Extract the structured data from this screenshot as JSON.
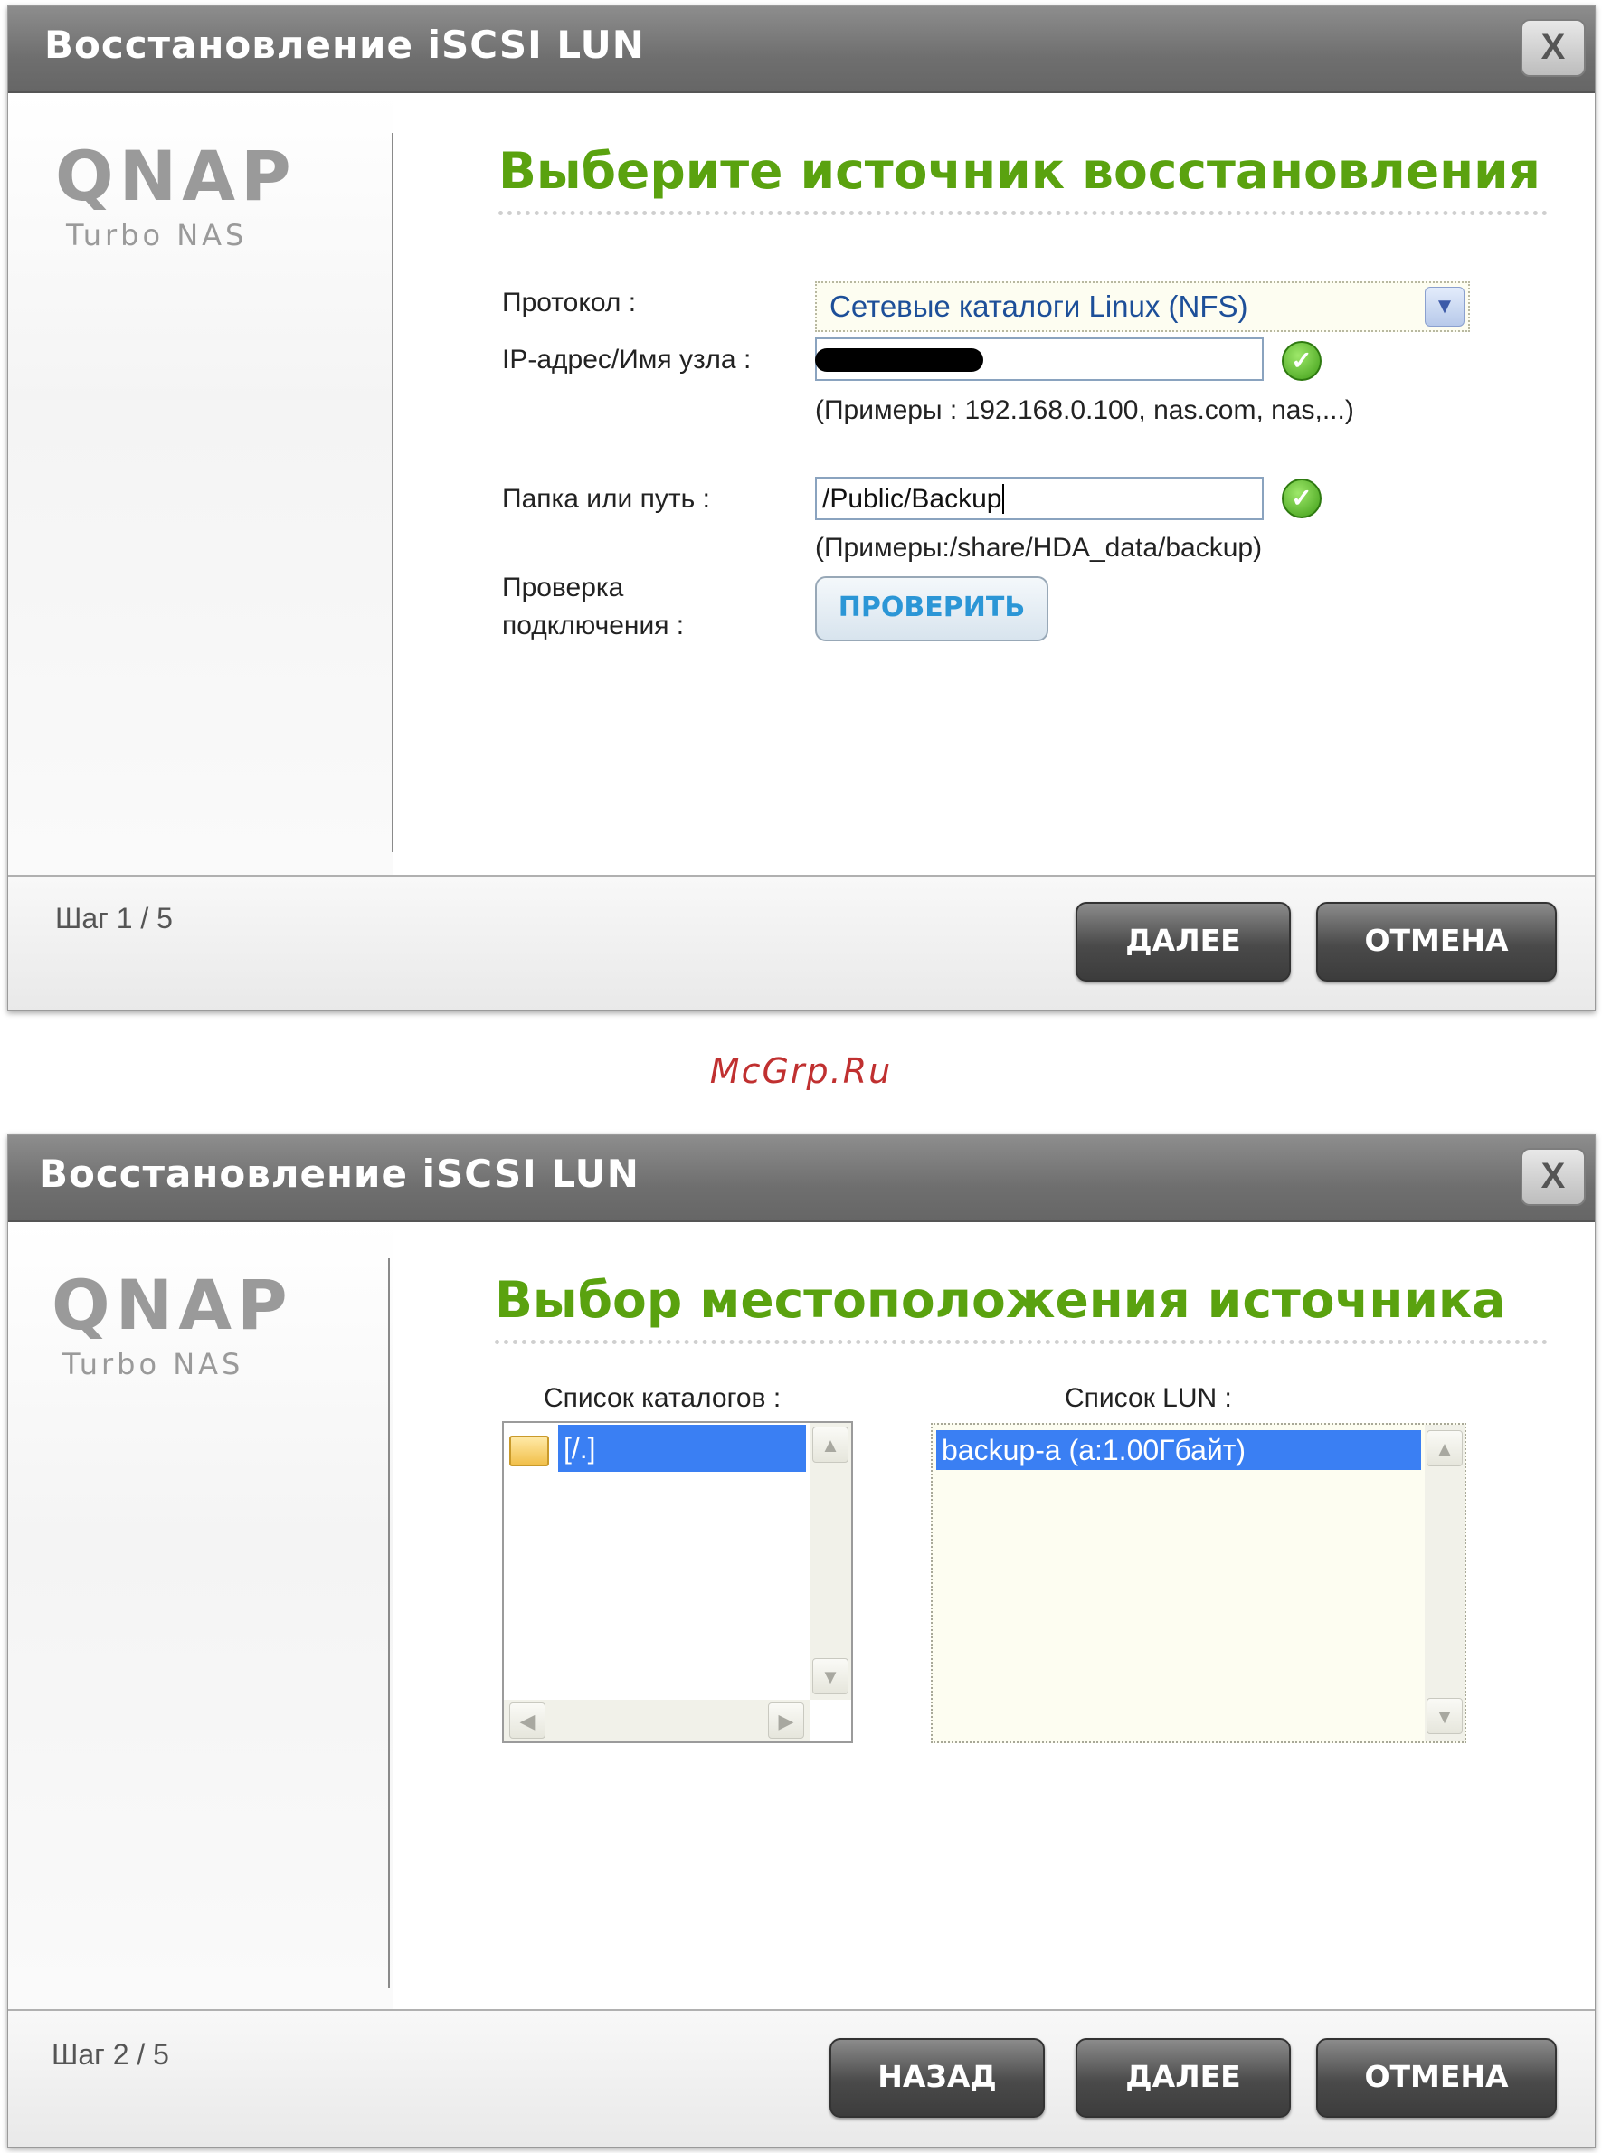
{
  "dialog1": {
    "title": "Восстановление iSCSI LUN",
    "close": "X",
    "logo": {
      "brand": "QNAP",
      "product": "Turbo NAS"
    },
    "heading": "Выберите источник восстановления",
    "protocol_label": "Протокол :",
    "protocol_value": "Сетевые каталоги Linux (NFS)",
    "ip_label": "IP-адрес/Имя узла :",
    "ip_hint": "(Примеры : 192.168.0.100, nas.com, nas,...)",
    "path_label": "Папка или путь :",
    "path_value": "/Public/Backup",
    "path_hint": "(Примеры:/share/HDA_data/backup)",
    "verify_label_line1": "Проверка",
    "verify_label_line2": "подключения :",
    "verify_button": "ПРОВЕРИТЬ",
    "step": "Шаг 1 / 5",
    "next_button": "ДАЛЕЕ",
    "cancel_button": "ОТМЕНА"
  },
  "watermark": "McGrp.Ru",
  "dialog2": {
    "title": "Восстановление iSCSI LUN",
    "close": "X",
    "logo": {
      "brand": "QNAP",
      "product": "Turbo NAS"
    },
    "heading": "Выбор местоположения источника",
    "catalog_list_label": "Список каталогов :",
    "catalog_items": [
      "[/.]"
    ],
    "lun_list_label": "Список LUN :",
    "lun_items": [
      "backup-a (a:1.00Гбайт)"
    ],
    "step": "Шаг 2 / 5",
    "back_button": "НАЗАД",
    "next_button": "ДАЛЕЕ",
    "cancel_button": "ОТМЕНА"
  },
  "colors": {
    "heading_green": "#5aa20f",
    "select_text_blue": "#1d4f99",
    "verify_blue": "#2b96d6",
    "selection_blue": "#3a7ff3",
    "titlebar_gray": "#777777"
  }
}
